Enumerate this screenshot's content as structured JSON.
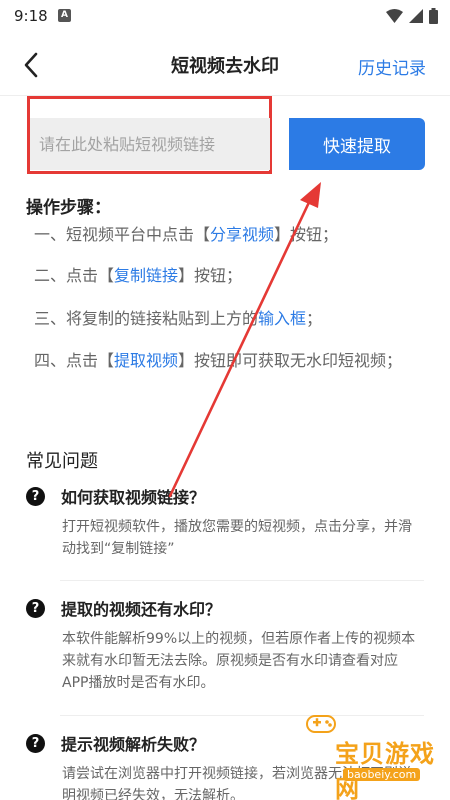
{
  "status": {
    "time": "9:18",
    "notif": "A"
  },
  "header": {
    "title": "短视频去水印",
    "history": "历史记录"
  },
  "search": {
    "placeholder": "请在此处粘贴短视频链接",
    "button": "快速提取"
  },
  "steps": {
    "title": "操作步骤：",
    "s1": {
      "pre": "一、短视频平台中点击【",
      "hl": "分享视频",
      "post": "】按钮；"
    },
    "s2": {
      "pre": "二、点击【",
      "hl": "复制链接",
      "post": "】按钮；"
    },
    "s3": {
      "pre": "三、将复制的链接粘贴到上方的",
      "hl": "输入框",
      "post": "；"
    },
    "s4": {
      "pre": "四、点击【",
      "hl": "提取视频",
      "post": "】按钮即可获取无水印短视频；"
    }
  },
  "faq": {
    "title": "常见问题",
    "q1": {
      "q": "如何获取视频链接？",
      "a": "打开短视频软件，播放您需要的短视频，点击分享，并滑动找到“复制链接”"
    },
    "q2": {
      "q": "提取的视频还有水印？",
      "a": "本软件能解析99%以上的视频，但若原作者上传的视频本来就有水印暂无法去除。原视频是否有水印请查看对应APP播放时是否有水印。"
    },
    "q3": {
      "q": "提示视频解析失败？",
      "a": "请尝试在浏览器中打开视频链接，若浏览器无法打开则说明视频已经失效，无法解析。"
    }
  },
  "watermark": {
    "text": "宝贝游戏网",
    "url": "baobeiy.com"
  },
  "colors": {
    "accent": "#2c7be5",
    "highlight_frame": "#e53935",
    "watermark": "#f4a21a"
  }
}
